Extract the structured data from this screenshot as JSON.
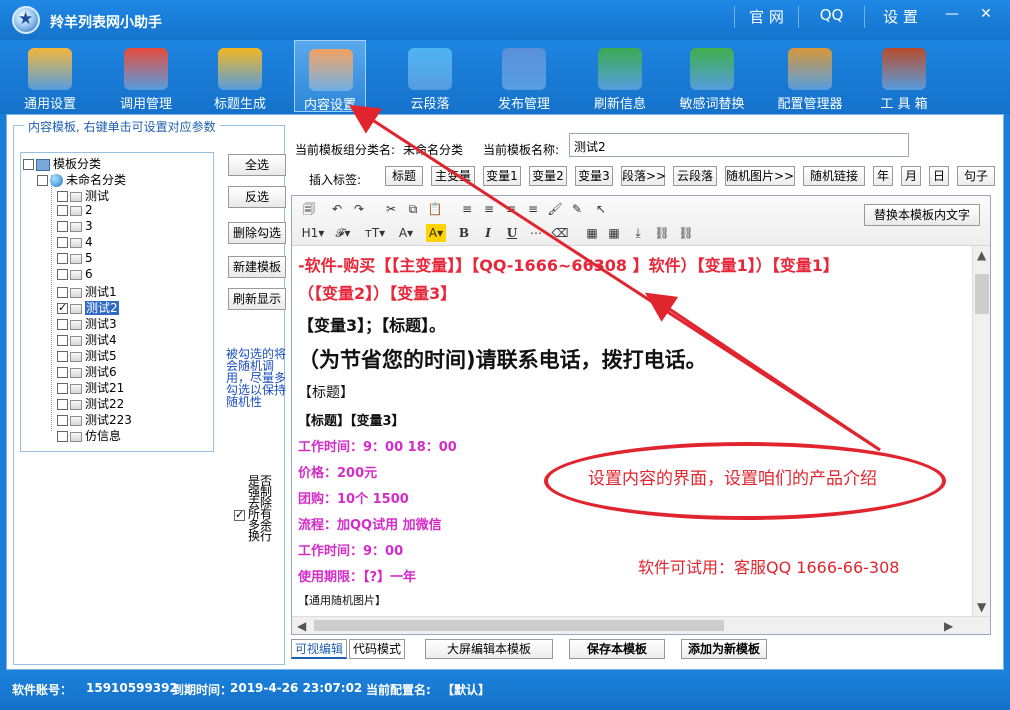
{
  "window": {
    "title": "羚羊列表网小助手"
  },
  "titlebar_links": [
    "官 网",
    "QQ",
    "设 置"
  ],
  "toolbar": [
    {
      "label": "通用设置",
      "icon": "tools-icon",
      "active": false
    },
    {
      "label": "调用管理",
      "icon": "edit-doc-icon",
      "active": false
    },
    {
      "label": "标题生成",
      "icon": "list-icon",
      "active": false
    },
    {
      "label": "内容设置",
      "icon": "hammer-folder-icon",
      "active": true
    },
    {
      "label": "云段落",
      "icon": "cloud-check-icon",
      "active": false
    },
    {
      "label": "发布管理",
      "icon": "publish-icon",
      "active": false
    },
    {
      "label": "刷新信息",
      "icon": "refresh-icon",
      "active": false
    },
    {
      "label": "敏感词替换",
      "icon": "shield-check-icon",
      "active": false
    },
    {
      "label": "配置管理器",
      "icon": "box-icon",
      "active": false
    },
    {
      "label": "工 具 箱",
      "icon": "toolbox-icon",
      "active": false
    }
  ],
  "left_panel": {
    "title": "内容模板, 右键单击可设置对应参数",
    "tree_root": "模板分类",
    "tree_group": "未命名分类",
    "tree_items": [
      "测试",
      "2",
      "3",
      "4",
      "5",
      "6",
      "测试1",
      "测试2",
      "测试3",
      "测试4",
      "测试5",
      "测试6",
      "测试21",
      "测试22",
      "测试223",
      "仿信息"
    ],
    "selected_item": "测试2",
    "buttons": [
      "全选",
      "反选",
      "删除勾选",
      "新建模板",
      "刷新显示"
    ],
    "note": "被勾选的将会随机调用，尽量多勾选以保持随机性",
    "vertical_note": "是否强制去除所有多余换行"
  },
  "header": {
    "group_label": "当前模板组分类名:",
    "group_value": "未命名分类",
    "name_label": "当前模板名称:",
    "name_value": "测试2",
    "insert_label": "插入标签:"
  },
  "tags": [
    "标题",
    "主变量",
    "变量1",
    "变量2",
    "变量3",
    "段落>>",
    "云段落",
    "随机图片>>",
    "随机链接",
    "年",
    "月",
    "日",
    "句子"
  ],
  "editor": {
    "replace_button": "替换本模板内文字",
    "toolbar_row1": [
      "🗐",
      "↶",
      "↷",
      "✂",
      "⧉",
      "📋",
      "≡",
      "≡",
      "≡",
      "≡",
      "🖌",
      "✎",
      "↖"
    ],
    "toolbar_row2": [
      "H1▾",
      "𝓕▾",
      "тT▾",
      "A▾",
      "A▾",
      "B",
      "I",
      "U",
      "⋯",
      "⌫",
      "▦",
      "▦",
      "⤓",
      "⛓",
      "⛓"
    ],
    "lines": [
      {
        "text": "-软件-购买【【主变量】】【QQ-1666~66308  】软件）【变量1】）【变量1】",
        "color": "#e8283a",
        "size": 16
      },
      {
        "text": "（【变量2】）【变量3】",
        "color": "#e8283a",
        "size": 16
      },
      {
        "text": "【变量3】；【标题】。",
        "color": "#111111",
        "size": 16
      },
      {
        "text": "（为节省您的时间)请联系电话，拨打电话。",
        "color": "#111111",
        "size": 21
      },
      {
        "text": "【标题】",
        "color": "#111111",
        "size": 14
      },
      {
        "text": "【标题】【变量3】",
        "color": "#111111",
        "size": 13
      },
      {
        "text": "工作时间：9：00  18：00",
        "color": "#d42cc9",
        "size": 13
      },
      {
        "text": "价格：200元",
        "color": "#d42cc9",
        "size": 13
      },
      {
        "text": "团购：10个  1500",
        "color": "#d42cc9",
        "size": 13
      },
      {
        "text": "流程：加QQ试用 加微信",
        "color": "#d42cc9",
        "size": 13
      },
      {
        "text": "工作时间：9：00",
        "color": "#d42cc9",
        "size": 13
      },
      {
        "text": "使用期限：【?】一年",
        "color": "#d42cc9",
        "size": 13
      },
      {
        "text": "【通用随机图片】",
        "color": "#111111",
        "size": 11
      }
    ]
  },
  "bottom": {
    "tab_visual": "可视编辑",
    "tab_code": "代码模式",
    "btn_big": "大屏编辑本模板",
    "btn_save": "保存本模板",
    "btn_add": "添加为新模板"
  },
  "annotations": {
    "oval_text": "设置内容的界面，设置咱们的产品介绍",
    "trial_text": "软件可试用：客服QQ 1666-66-308",
    "color": "#e0252e"
  },
  "status": {
    "account_label": "软件账号：",
    "account_value": "15910599392",
    "expire_label": "到期时间：",
    "expire_value": "2019-4-26 23:07:02",
    "config_label": "当前配置名:",
    "config_value": "【默认】"
  }
}
